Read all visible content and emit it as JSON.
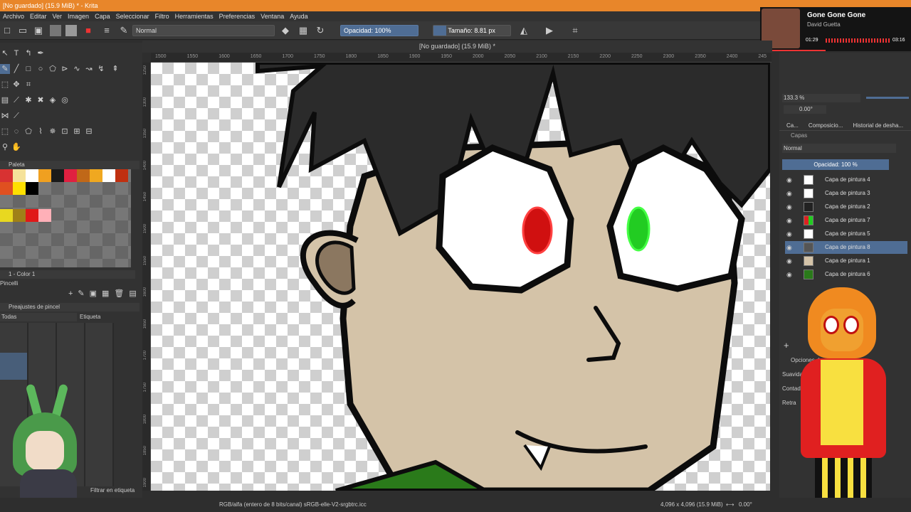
{
  "window": {
    "title": "[No guardado]  (15.9 MiB) * - Krita"
  },
  "menu": [
    "Archivo",
    "Editar",
    "Ver",
    "Imagen",
    "Capa",
    "Seleccionar",
    "Filtro",
    "Herramientas",
    "Preferencias",
    "Ventana",
    "Ayuda"
  ],
  "toolbar": {
    "blend_mode": "Normal",
    "opacity": "Opacidad: 100%",
    "size": "Tamaño: 8.81 px"
  },
  "media": {
    "song": "Gone Gone Gone",
    "artist": "David Guetta",
    "elapsed": "01:29",
    "duration": "03:16"
  },
  "document": {
    "tab_title": "[No guardado]  (15.9 MiB) *"
  },
  "rulers": {
    "top": [
      "1500",
      "1550",
      "1600",
      "1650",
      "1700",
      "1750",
      "1800",
      "1850",
      "1900",
      "1950",
      "2000",
      "2050",
      "2100",
      "2150",
      "2200",
      "2250",
      "2300",
      "2350",
      "2400",
      "245"
    ],
    "left": [
      "1250",
      "1300",
      "1350",
      "1400",
      "1450",
      "1500",
      "1550",
      "1600",
      "1650",
      "1700",
      "1750",
      "1800",
      "1850",
      "1900"
    ]
  },
  "palette": {
    "title": "Paleta",
    "current_color": "1 - Color 1",
    "footer": "Pincelli"
  },
  "brush_presets": {
    "title": "Preajustes de pincel",
    "filter": "Todas",
    "tag": "Etiqueta",
    "filter_tag": "Filtrar en etiqueta"
  },
  "navigator": {
    "zoom": "133.3 %",
    "rotation": "0.00°"
  },
  "tabs": [
    "Ca...",
    "Composicio...",
    "Historial de desha..."
  ],
  "layers": {
    "title": "Capas",
    "blend": "Normal",
    "opacity": "Opacidad:  100 %",
    "items": [
      {
        "name": "Capa de pintura 4",
        "selected": false
      },
      {
        "name": "Capa de pintura 3",
        "selected": false
      },
      {
        "name": "Capa de pintura 2",
        "selected": false
      },
      {
        "name": "Capa de pintura 7",
        "selected": false
      },
      {
        "name": "Capa de pintura 5",
        "selected": false
      },
      {
        "name": "Capa de pintura 8",
        "selected": true
      },
      {
        "name": "Capa de pintura 1",
        "selected": false
      },
      {
        "name": "Capa de pintura 6",
        "selected": false
      }
    ]
  },
  "tool_options": {
    "title": "Opciones de",
    "smoothing": "Suavidad del pincel",
    "contour": "Contad",
    "retrace": "Retra"
  },
  "status": {
    "color_space": "RGB/alfa (entero de 8 bits/canal)  sRGB-elle-V2-srgbtrc.icc",
    "dimensions": "4,096 x 4,096 (15.9 MiB)",
    "angle": "0.00°"
  },
  "colors": {
    "accent": "#e8862a",
    "selection": "#4f6d94",
    "skin": "#d4c3a8",
    "hair": "#2b2b2b",
    "eye_left": "#d01010",
    "eye_right": "#22cc22"
  }
}
